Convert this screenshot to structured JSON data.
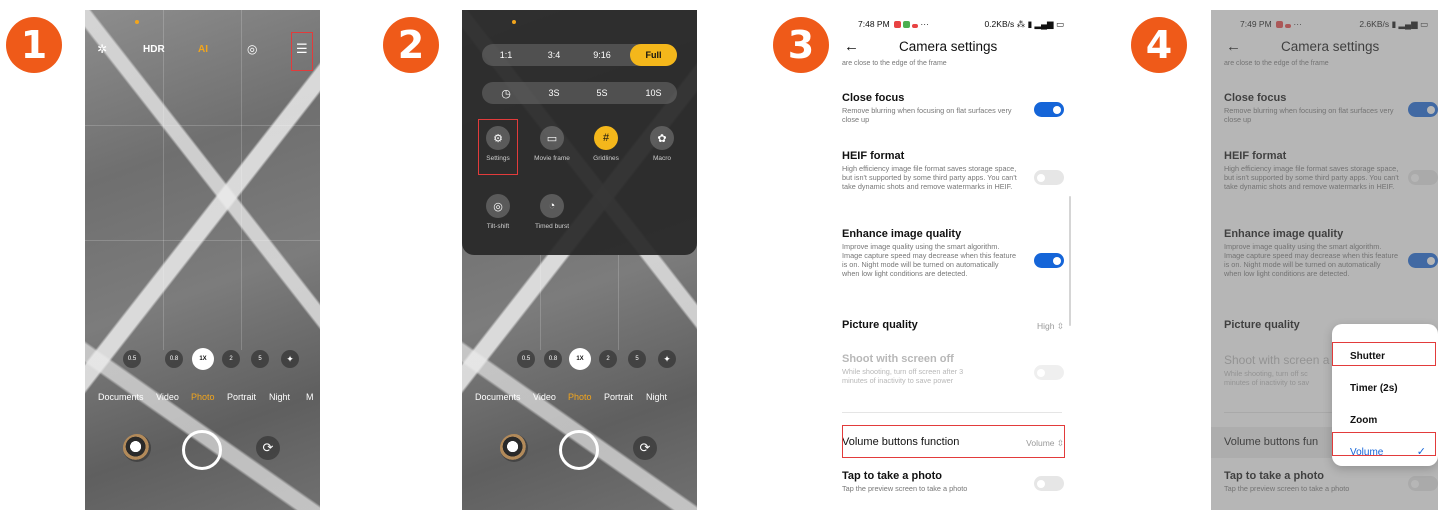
{
  "steps": [
    "1",
    "2",
    "3",
    "4"
  ],
  "colors": {
    "badge": "#ef5a19",
    "accent_orange": "#f2a51c",
    "toggle_on": "#1565d8",
    "highlight": "#e23b3b"
  },
  "panel1": {
    "top_bar": {
      "hdr": "HDR",
      "ai": "AI"
    },
    "zoom": [
      "0.5",
      "0.8",
      "1X",
      "2",
      "5"
    ],
    "modes": [
      "Documents",
      "Video",
      "Photo",
      "Portrait",
      "Night",
      "M"
    ]
  },
  "panel2": {
    "aspect_ratios": [
      "1:1",
      "3:4",
      "9:16",
      "Full"
    ],
    "timers": [
      "3S",
      "5S",
      "10S"
    ],
    "tiles": [
      "Settings",
      "Movie frame",
      "Gridlines",
      "Macro",
      "Tilt-shift",
      "Timed burst"
    ],
    "zoom": [
      "0.5",
      "0.8",
      "1X",
      "2",
      "5"
    ],
    "modes": [
      "Documents",
      "Video",
      "Photo",
      "Portrait",
      "Night"
    ]
  },
  "panel3": {
    "status_left": "7:48 PM",
    "status_right": "0.2KB/s",
    "header": "Camera settings",
    "cutoff": "are close to the edge of the frame",
    "close_focus": {
      "title": "Close focus",
      "desc": "Remove blurring when focusing on flat surfaces very close up"
    },
    "heif": {
      "title": "HEIF format",
      "desc": "High efficiency image file format saves storage space, but isn't supported by some third party apps. You can't take dynamic shots and remove watermarks in HEIF."
    },
    "enhance": {
      "title": "Enhance image quality",
      "desc": "Improve image quality using the smart algorithm. Image capture speed may decrease when this feature is on. Night mode will be turned on automatically when low light conditions are detected."
    },
    "picture_quality": {
      "title": "Picture quality",
      "value": "High"
    },
    "screen_off": {
      "title": "Shoot with screen off",
      "desc": "While shooting, turn off screen after 3 minutes of inactivity to save power"
    },
    "volume": {
      "title": "Volume buttons function",
      "value": "Volume"
    },
    "tap_photo": {
      "title": "Tap to take a photo",
      "desc": "Tap the preview screen to take a photo"
    }
  },
  "panel4": {
    "status_left": "7:49 PM",
    "status_right": "2.6KB/s",
    "header": "Camera settings",
    "cutoff": "are close to the edge of the frame",
    "close_focus": {
      "title": "Close focus",
      "desc": "Remove blurring when focusing on flat surfaces very close up"
    },
    "heif": {
      "title": "HEIF format",
      "desc": "High efficiency image file format saves storage space, but isn't supported by some third party apps. You can't take dynamic shots and remove watermarks in HEIF."
    },
    "enhance": {
      "title": "Enhance image quality",
      "desc": "Improve image quality using the smart algorithm. Image capture speed may decrease when this feature is on. Night mode will be turned on automatically when low light conditions are detected."
    },
    "picture_quality": {
      "title": "Picture quality"
    },
    "screen_off": {
      "title": "Shoot with screen a",
      "desc": "While shooting, turn off sc minutes of inactivity to sav"
    },
    "volume": {
      "title": "Volume buttons fun"
    },
    "tap_photo": {
      "title": "Tap to take a photo",
      "desc": "Tap the preview screen to take a photo"
    },
    "popup_options": [
      "Shutter",
      "Timer (2s)",
      "Zoom",
      "Volume"
    ]
  }
}
